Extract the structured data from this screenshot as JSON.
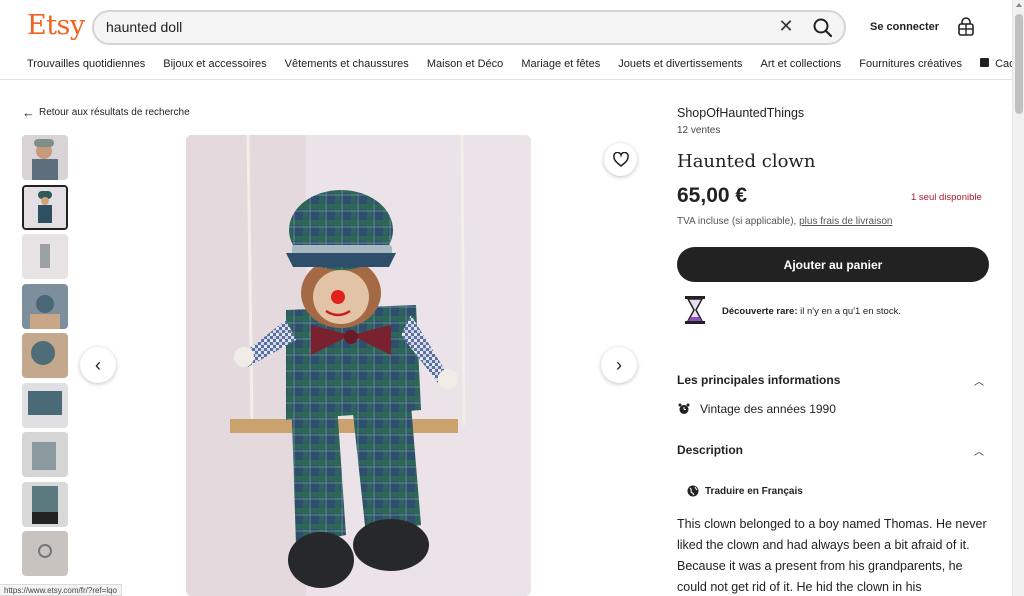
{
  "header": {
    "logo": "Etsy",
    "search_value": "haunted doll",
    "signin_label": "Se connecter"
  },
  "categories": [
    "Trouvailles quotidiennes",
    "Bijoux et accessoires",
    "Vêtements et chaussures",
    "Maison et Déco",
    "Mariage et fêtes",
    "Jouets et divertissements",
    "Art et collections",
    "Fournitures créatives",
    "Cadeaux"
  ],
  "back_label": "Retour aux résultats de recherche",
  "status_url": "https://www.etsy.com/fr/?ref=lqo",
  "listing": {
    "shop_name": "ShopOfHauntedThings",
    "sales": "12 ventes",
    "title": "Haunted clown",
    "price": "65,00 €",
    "availability": "1 seul disponible",
    "tax_text": "TVA incluse (si applicable),",
    "shipping_link": "plus frais de livraison",
    "cart_button": "Ajouter au panier",
    "rare_bold": "Découverte rare:",
    "rare_text": "il n'y en a qu'1 en stock."
  },
  "details": {
    "heading": "Les principales informations",
    "vintage": "Vintage des années 1990"
  },
  "description": {
    "heading": "Description",
    "translate_label": "Traduire en Français",
    "text": "This clown belonged to a boy named Thomas. He never liked the clown and had always been a bit afraid of it. Because it was a present from his grandparents, he could not get rid of it. He hid the clown in his"
  },
  "colors": {
    "brand": "#f1641e",
    "alert": "#a61a2e",
    "button": "#222222"
  }
}
